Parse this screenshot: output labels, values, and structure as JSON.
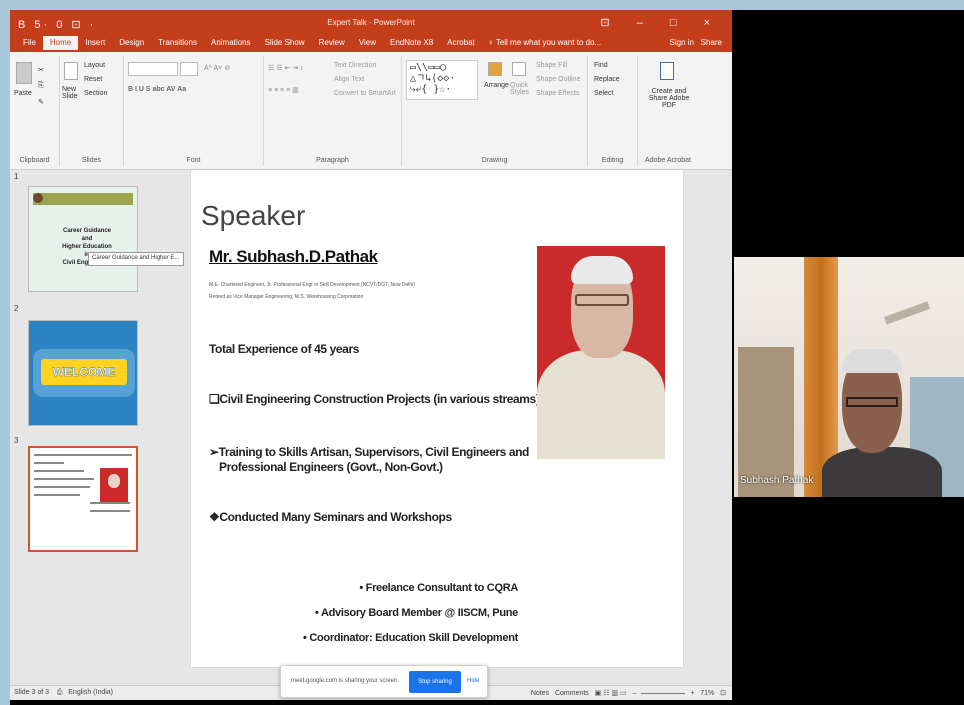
{
  "powerpoint": {
    "title_bar": {
      "quick_access": "B 5· 0 ⊡ ·",
      "document_title": "Expert Talk - PowerPoint",
      "window_controls": "⊡ – □ ×"
    },
    "tabs": [
      "File",
      "Home",
      "Insert",
      "Design",
      "Transitions",
      "Animations",
      "Slide Show",
      "Review",
      "View",
      "EndNote X8",
      "Acrobat"
    ],
    "active_tab": "Home",
    "tell_me": "♀ Tell me what you want to do...",
    "account": {
      "sign_in": "Sign in",
      "share": "Share"
    },
    "ribbon": {
      "groups": [
        "Clipboard",
        "Slides",
        "Font",
        "Paragraph",
        "Drawing",
        "Editing",
        "Adobe Acrobat"
      ],
      "paste_label": "Paste",
      "new_slide_label": "New Slide",
      "slide_buttons": [
        "Layout",
        "Reset",
        "Section"
      ],
      "text_direction": "Text Direction",
      "align_text": "Align Text",
      "convert_smartart": "Convert to SmartArt",
      "arrange_label": "Arrange",
      "quick_styles_label": "Quick Styles",
      "shape_fill": "Shape Fill",
      "shape_outline": "Shape Outline",
      "shape_effects": "Shape Effects",
      "find": "Find",
      "replace": "Replace",
      "select": "Select",
      "create_share_pdf": "Create and Share Adobe PDF"
    },
    "thumbnails": [
      {
        "number": "1",
        "lines": [
          "Career Guidance",
          "and",
          "Higher Education",
          "in",
          "Civil Engineering"
        ],
        "tooltip": "Career Guidance and Higher E..."
      },
      {
        "number": "2",
        "banner": "WELCOME"
      },
      {
        "number": "3"
      }
    ],
    "slide": {
      "title": "Speaker",
      "name": "Mr. Subhash.D.Pathak",
      "credentials_1": "M.E. Chartered Engineer, Jt. Professional Engr in Skill Development (NCVT/DGT, New Delhi)",
      "credentials_2": "Retired as Vice Manager Engineering, M.S. Warehousing Corporation",
      "experience": "Total Experience of 45 years",
      "bullet_1": "❑Civil Engineering Construction Projects (in various streams)",
      "bullet_2_line1": "➢Training to Skills Artisan, Supervisors, Civil Engineers and",
      "bullet_2_line2": "Professional Engineers (Govt., Non-Govt.)",
      "bullet_3": "❖Conducted Many Seminars and Workshops",
      "right_bullets": [
        "• Freelance Consultant to CQRA",
        "• Advisory Board Member @ IISCM, Pune",
        "• Coordinator: Education Skill Development"
      ]
    },
    "status_bar": {
      "slide_info": "Slide 3 of 3",
      "language": "English (India)",
      "notes": "Notes",
      "comments": "Comments",
      "zoom_minus": "–",
      "zoom_plus": "+",
      "zoom_level": "71%"
    }
  },
  "screen_share_bar": {
    "message": "meet.google.com is sharing your screen.",
    "stop_button": "Stop sharing",
    "hide_button": "Hide"
  },
  "participant": {
    "name": "Subhash Pathak"
  },
  "colors": {
    "powerpoint_accent": "#c43e1c",
    "stop_sharing_blue": "#1a73e8",
    "photo_background_red": "#c92b2b"
  }
}
